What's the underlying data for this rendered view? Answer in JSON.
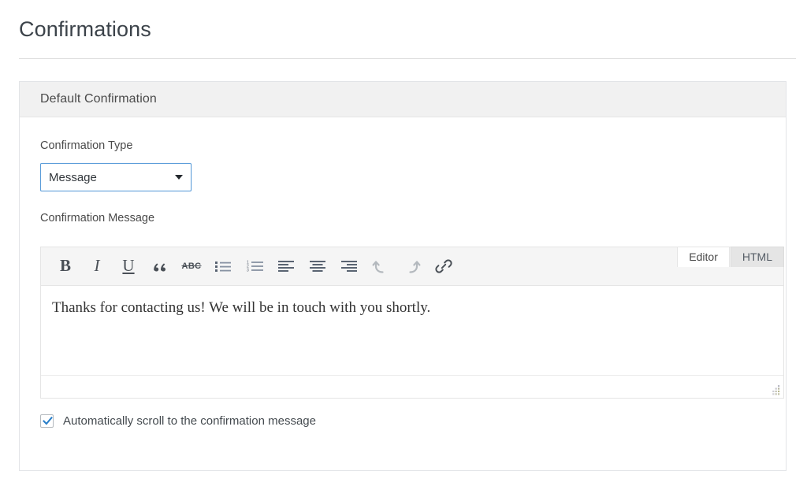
{
  "page": {
    "title": "Confirmations"
  },
  "panel": {
    "header_title": "Default Confirmation"
  },
  "form": {
    "confirmation_type": {
      "label": "Confirmation Type",
      "value": "Message",
      "arrow_icon": "chevron-down-icon"
    },
    "confirmation_message": {
      "label": "Confirmation Message"
    },
    "auto_scroll": {
      "label": "Automatically scroll to the confirmation message",
      "checked": true,
      "check_color": "#2a7fc9"
    }
  },
  "editor": {
    "tabs": [
      {
        "label": "Editor",
        "active": true
      },
      {
        "label": "HTML",
        "active": false
      }
    ],
    "toolbar": [
      {
        "name": "bold-icon",
        "glyph": "B",
        "disabled": false
      },
      {
        "name": "italic-icon",
        "glyph": "I",
        "disabled": false
      },
      {
        "name": "underline-icon",
        "glyph": "U",
        "disabled": false
      },
      {
        "name": "blockquote-icon",
        "glyph": "“",
        "disabled": false
      },
      {
        "name": "strikethrough-icon",
        "glyph": "ABC",
        "disabled": false
      },
      {
        "name": "bulleted-list-icon",
        "glyph": "",
        "disabled": false
      },
      {
        "name": "numbered-list-icon",
        "glyph": "",
        "disabled": false
      },
      {
        "name": "align-left-icon",
        "glyph": "",
        "disabled": false
      },
      {
        "name": "align-center-icon",
        "glyph": "",
        "disabled": false
      },
      {
        "name": "align-right-icon",
        "glyph": "",
        "disabled": false
      },
      {
        "name": "undo-icon",
        "glyph": "",
        "disabled": true
      },
      {
        "name": "redo-icon",
        "glyph": "",
        "disabled": true
      },
      {
        "name": "link-icon",
        "glyph": "",
        "disabled": false
      }
    ],
    "content_text": "Thanks for contacting us! We will be in touch with you shortly.",
    "resize_handle": "resize-grip-icon"
  },
  "colors": {
    "accent_border": "#5b9dd9",
    "panel_header_bg": "#f1f1f1",
    "toolbar_bg": "#f5f5f5",
    "text": "#4a4a4a"
  }
}
